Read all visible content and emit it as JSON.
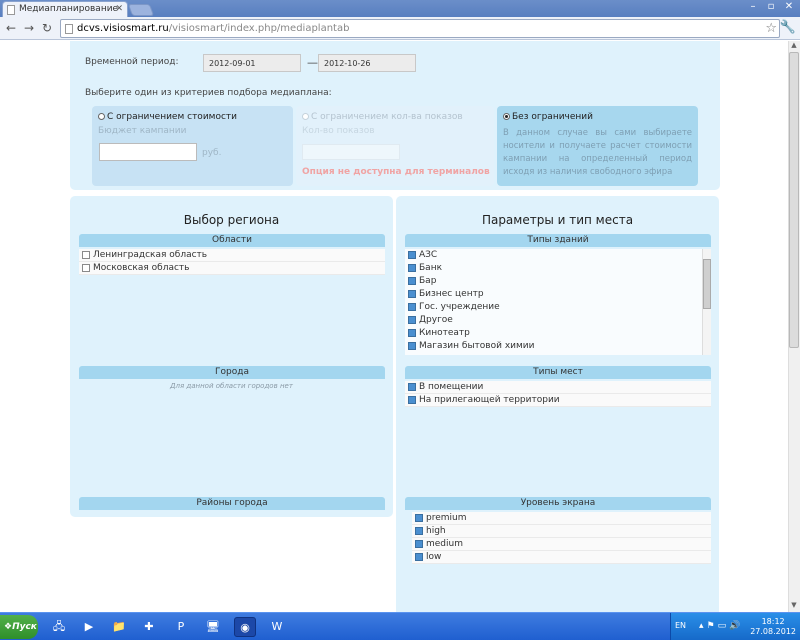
{
  "browser": {
    "tab_title": "Медиапланирование",
    "url_host": "dcvs.visiosmart.ru",
    "url_path": "/visiosmart/index.php/mediaplantab"
  },
  "period": {
    "label": "Временной период:",
    "from": "2012-09-01",
    "separator": "—",
    "to": "2012-10-26"
  },
  "criteria": {
    "prompt": "Выберите один из критериев подбора медиаплана:",
    "cost": {
      "title": "С ограничением стоимости",
      "budget_label": "Бюджет кампании",
      "currency": "руб."
    },
    "count": {
      "title": "С ограничением кол-ва показов",
      "count_label": "Кол-во показов",
      "warning": "Опция не доступна для терминалов"
    },
    "unlimited": {
      "title": "Без ограничений",
      "description": "В данном случае вы сами выбираете носители и получаете расчет стоимости кампании на определенный период исходя из наличия свободного эфира",
      "selected": true
    }
  },
  "region": {
    "title": "Выбор региона",
    "areas_header": "Области",
    "areas": [
      "Ленинградская область",
      "Московская область"
    ],
    "cities_header": "Города",
    "cities_empty": "Для данной области городов нет",
    "districts_header": "Районы города"
  },
  "params": {
    "title": "Параметры и тип места",
    "building_types_header": "Типы зданий",
    "building_types": [
      "АЗС",
      "Банк",
      "Бар",
      "Бизнес центр",
      "Гос. учреждение",
      "Другое",
      "Кинотеатр",
      "Магазин бытовой химии"
    ],
    "place_types_header": "Типы мест",
    "place_types": [
      "В помещении",
      "На прилегающей территории"
    ],
    "screen_level_header": "Уровень экрана",
    "screen_levels": [
      "premium",
      "high",
      "medium",
      "low"
    ]
  },
  "taskbar": {
    "start_label": "Пуск",
    "lang": "EN",
    "time": "18:12",
    "date": "27.08.2012"
  }
}
